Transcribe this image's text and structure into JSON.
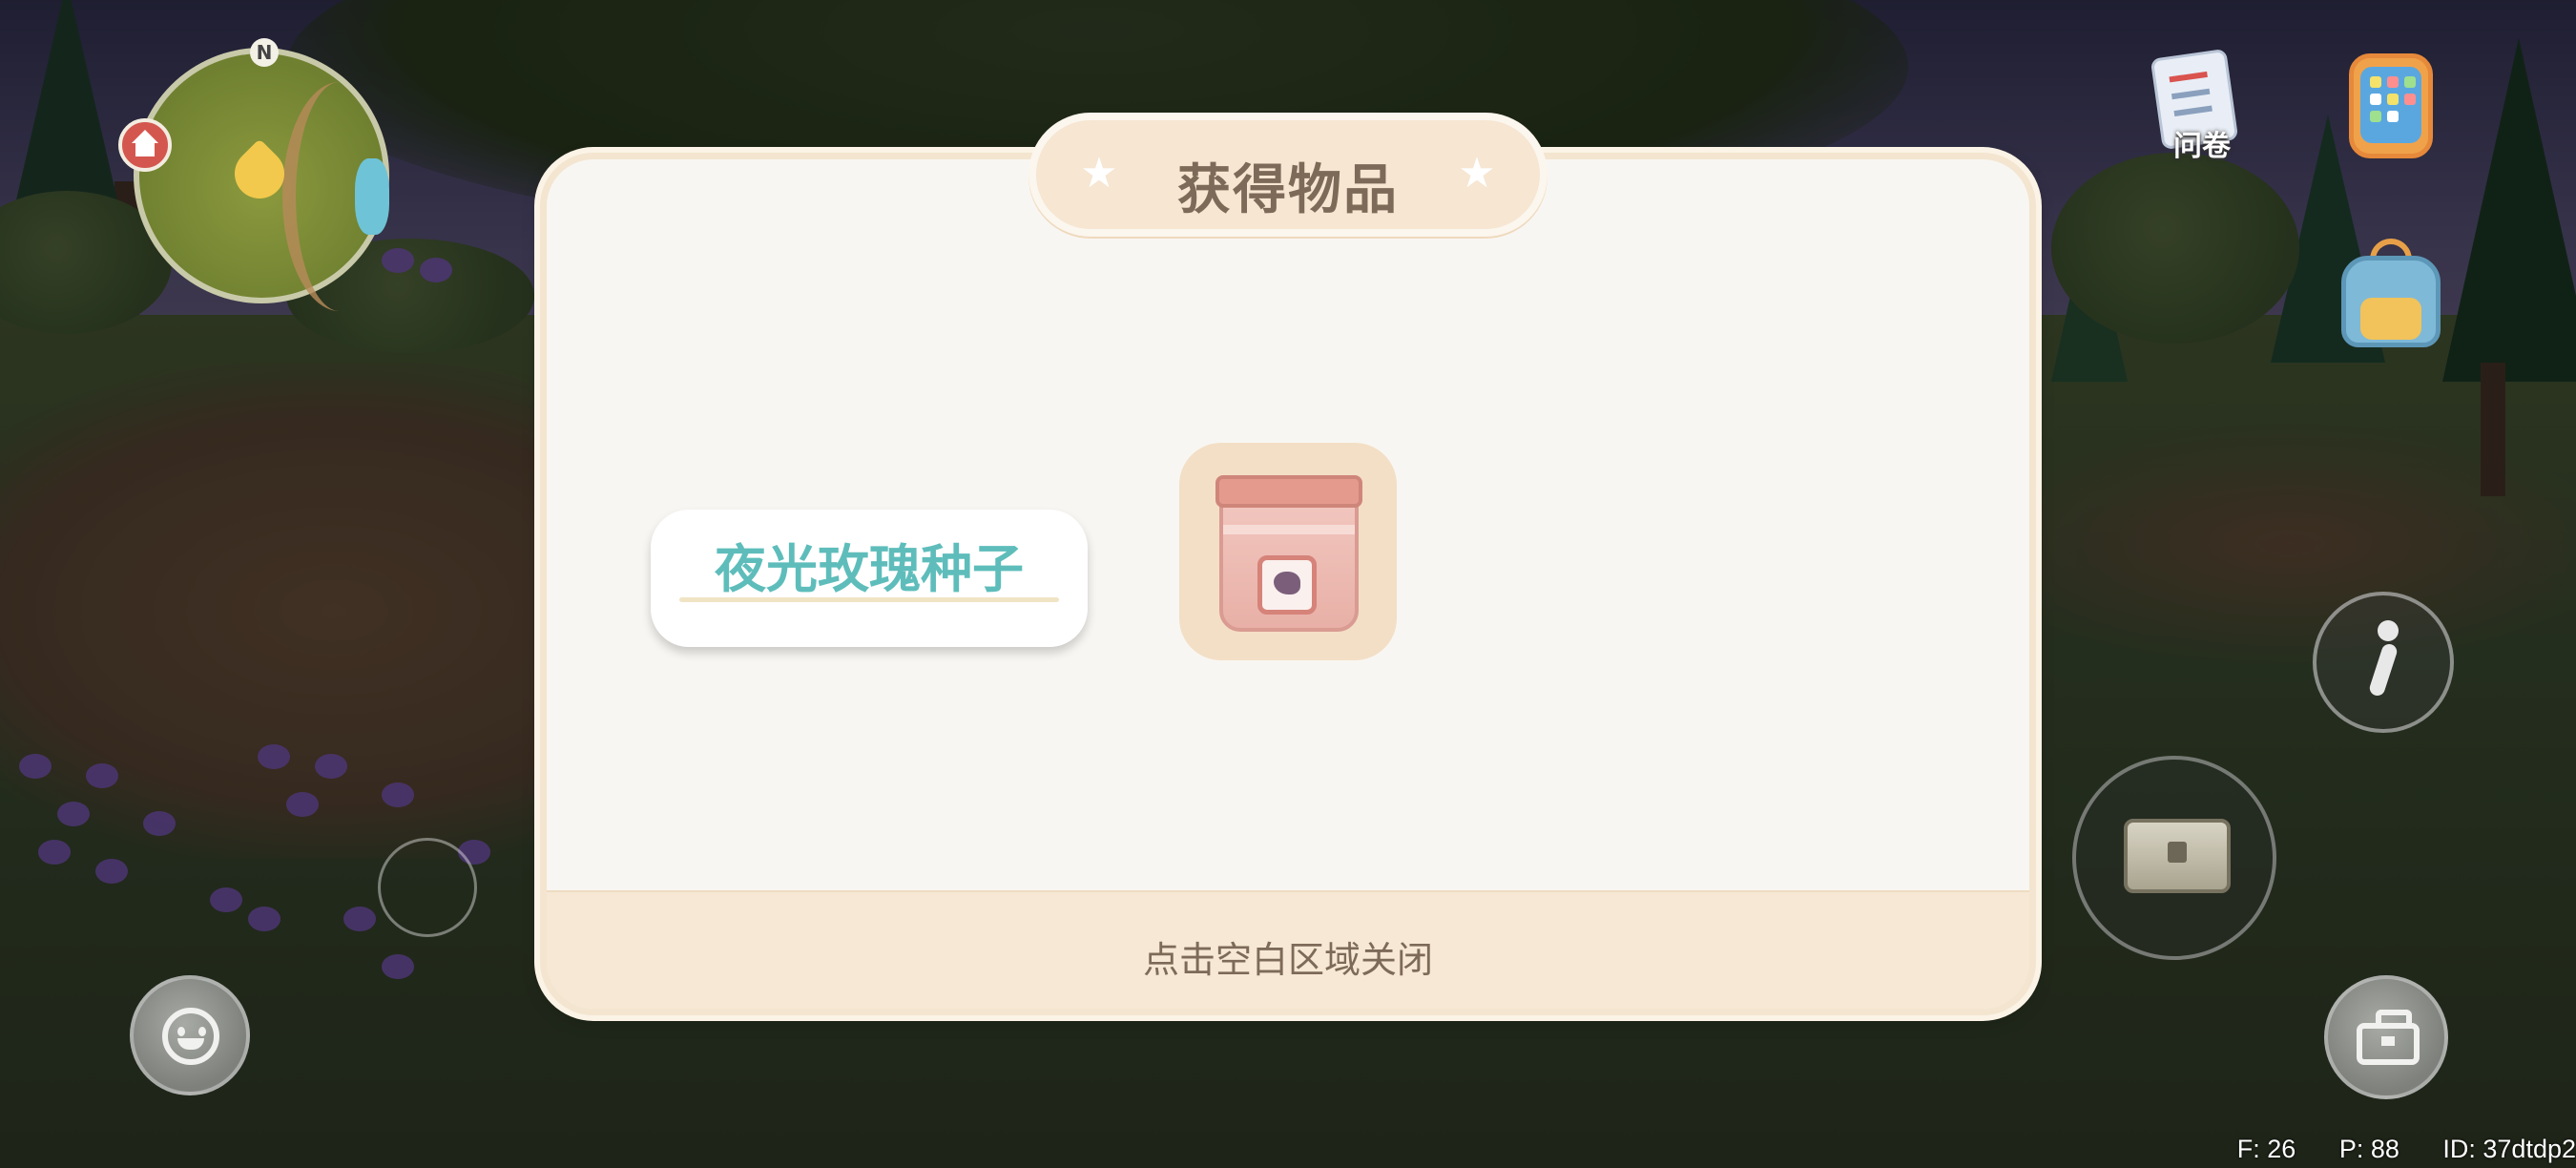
{
  "minimap": {
    "compass": "N",
    "home_icon": "home-icon",
    "player_marker": "player-marker-icon"
  },
  "hud": {
    "survey_label": "问卷",
    "survey_icon": "survey-clipboard-icon",
    "phone_icon": "phone-icon",
    "backpack_icon": "backpack-icon",
    "emote_icon": "smiley-face-icon",
    "dance_icon": "dance-figure-icon",
    "chest_icon": "storage-chest-icon",
    "toolbox_icon": "toolbox-icon"
  },
  "modal": {
    "title": "获得物品",
    "title_star": "★",
    "item": {
      "name": "夜光玫瑰种子",
      "icon": "seed-bag-icon"
    },
    "footer_hint": "点击空白区域关闭"
  },
  "debug": {
    "fps": "F: 26",
    "ping": "P: 88",
    "id": "ID: 37dtdp2"
  },
  "colors": {
    "item_name": "#5ebdbb",
    "modal_bg": "#f8f6f2",
    "title_plate": "#f6e6d2",
    "footer_bg": "#f6e8d4",
    "text_brown": "#7d6a58"
  }
}
